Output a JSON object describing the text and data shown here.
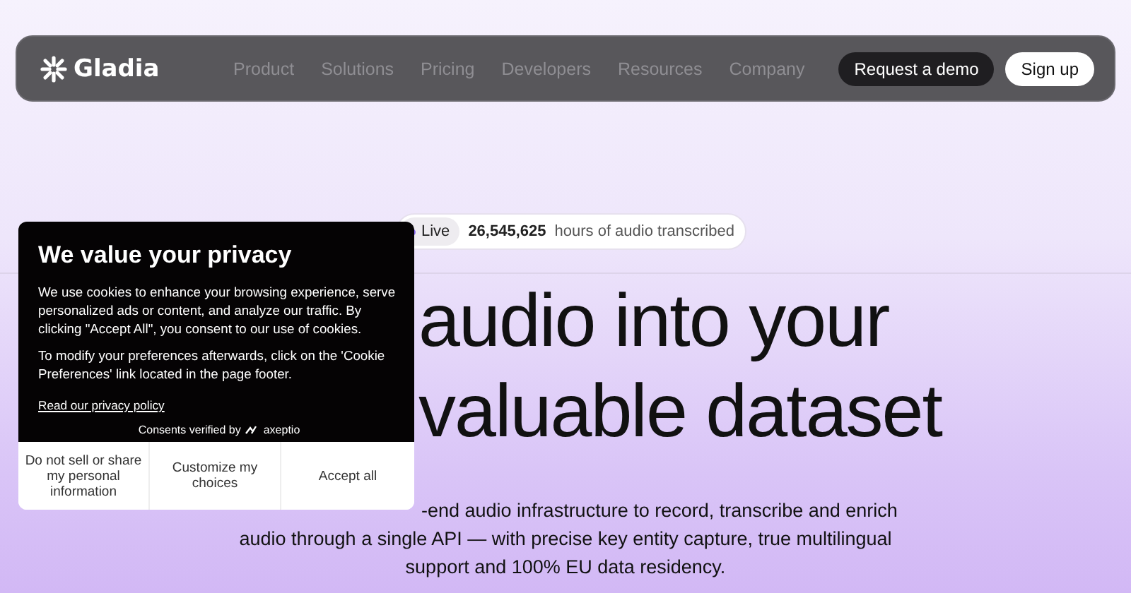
{
  "nav": {
    "logo": "Gladia",
    "links": [
      "Product",
      "Solutions",
      "Pricing",
      "Developers",
      "Resources",
      "Company"
    ],
    "buttons": [
      {
        "label": "Request a demo",
        "kind": "dark"
      },
      {
        "label": "Sign up",
        "kind": "light"
      }
    ]
  },
  "hero": {
    "live_label": "Live",
    "counter": "26,545,625",
    "counter_caption": "hours of audio transcribed",
    "headline": [
      "audio into your",
      "valuable dataset"
    ],
    "description": [
      "-end audio infrastructure to record, transcribe and enrich",
      "audio through a single API — with precise key entity capture, true multilingual",
      "support and 100% EU data residency."
    ]
  },
  "consent": {
    "title": "We value your privacy",
    "paragraphs": [
      "We use cookies to enhance your browsing experience, serve personalized ads or content, and analyze our traffic. By clicking \"Accept All\", you consent to our use of cookies.",
      "To modify your preferences afterwards, click on the 'Cookie Preferences' link located in the page footer."
    ],
    "policy_link": "Read our privacy policy",
    "verified_by": "Consents verified by",
    "brand": "axeptio",
    "buttons": [
      "Do not sell or share my personal information",
      "Customize my choices",
      "Accept all"
    ]
  }
}
